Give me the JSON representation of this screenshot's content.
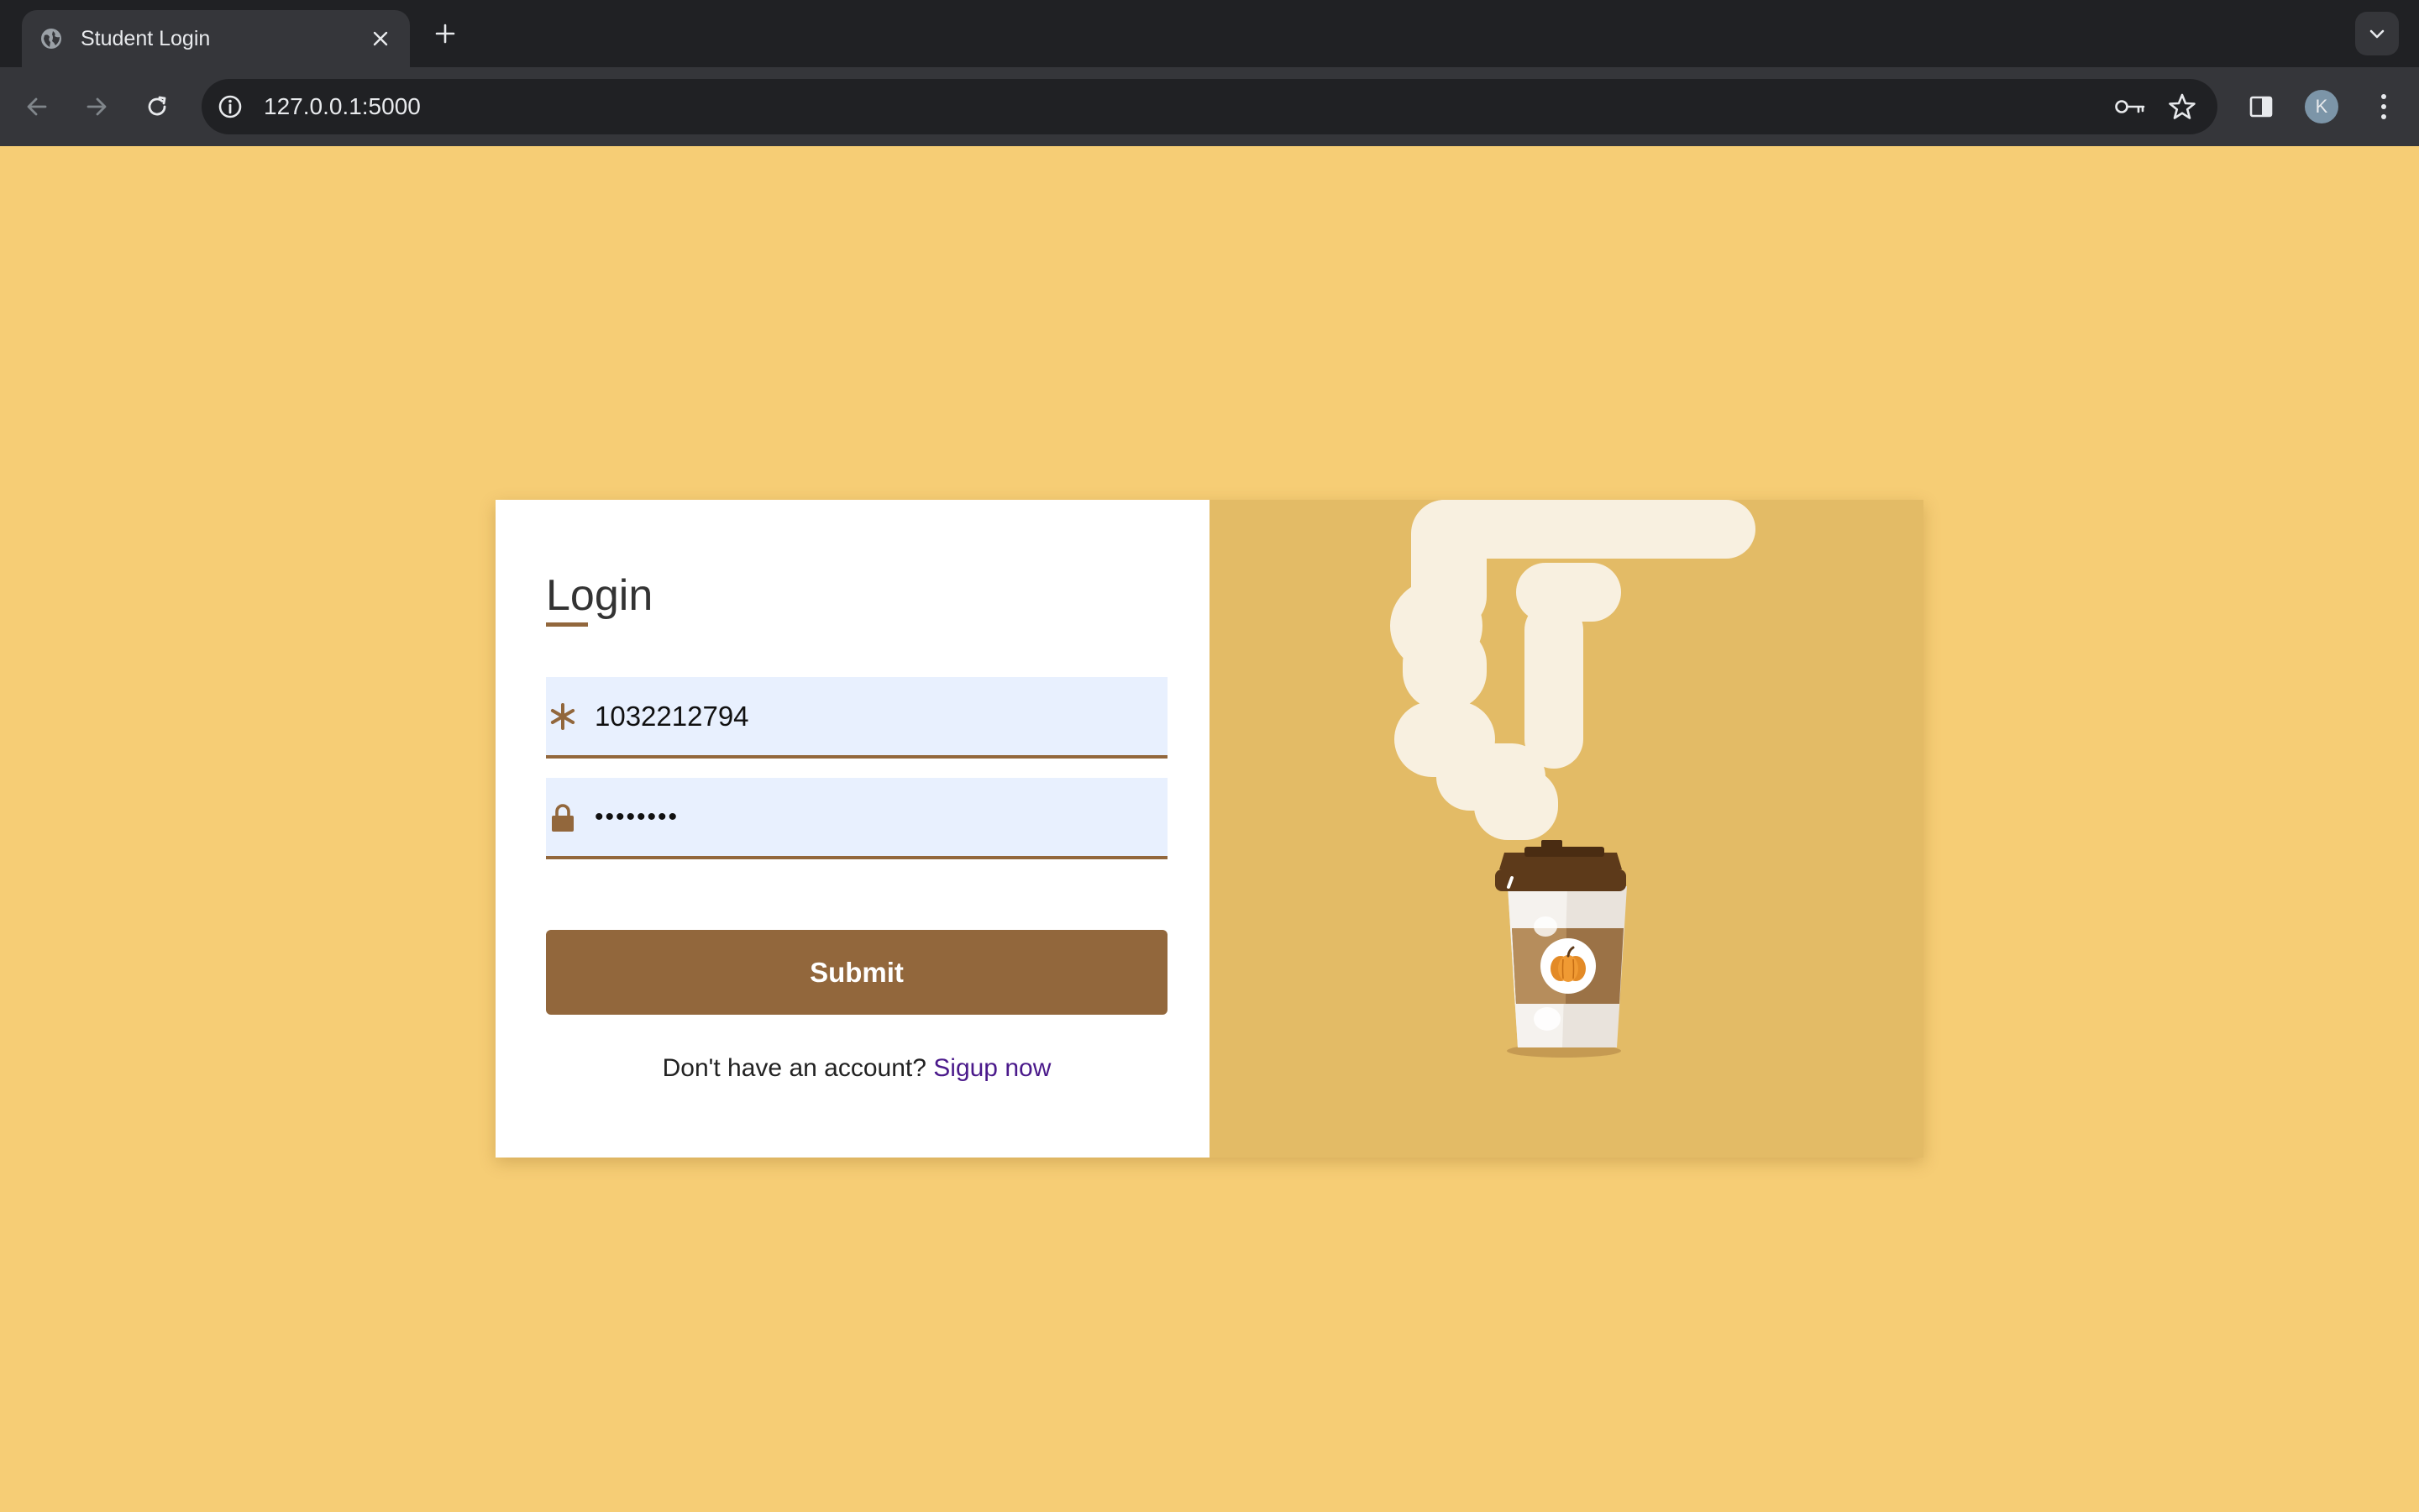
{
  "browser": {
    "tab_title": "Student Login",
    "url": "127.0.0.1:5000",
    "profile_initial": "K",
    "icons": {
      "tab_favicon": "globe-icon",
      "tab_close": "close-icon",
      "new_tab": "plus-icon",
      "tab_search": "chevron-down-icon",
      "back": "arrow-left-icon",
      "forward": "arrow-right-icon",
      "reload": "reload-icon",
      "site_info": "info-icon",
      "passwords": "key-icon",
      "bookmark": "star-icon",
      "side_panel": "side-panel-icon",
      "menu": "more-vert-icon"
    }
  },
  "login": {
    "title": "Login",
    "username_value": "1032212794",
    "password_value": "password",
    "submit_label": "Submit",
    "signup_prompt": "Don't have an account?",
    "signup_link": "Sigup now",
    "icons": {
      "username": "asterisk-icon",
      "password": "lock-icon"
    }
  },
  "illustration": {
    "subject": "coffee-cup-with-steam",
    "badge": "pumpkin-icon"
  },
  "colors": {
    "page_background": "#f6cd75",
    "accent_brown": "#92673c",
    "illustration_background": "#e3bb66",
    "steam": "#f8f0e0",
    "input_background": "#e8f0fe",
    "link": "#4b1a8b"
  }
}
